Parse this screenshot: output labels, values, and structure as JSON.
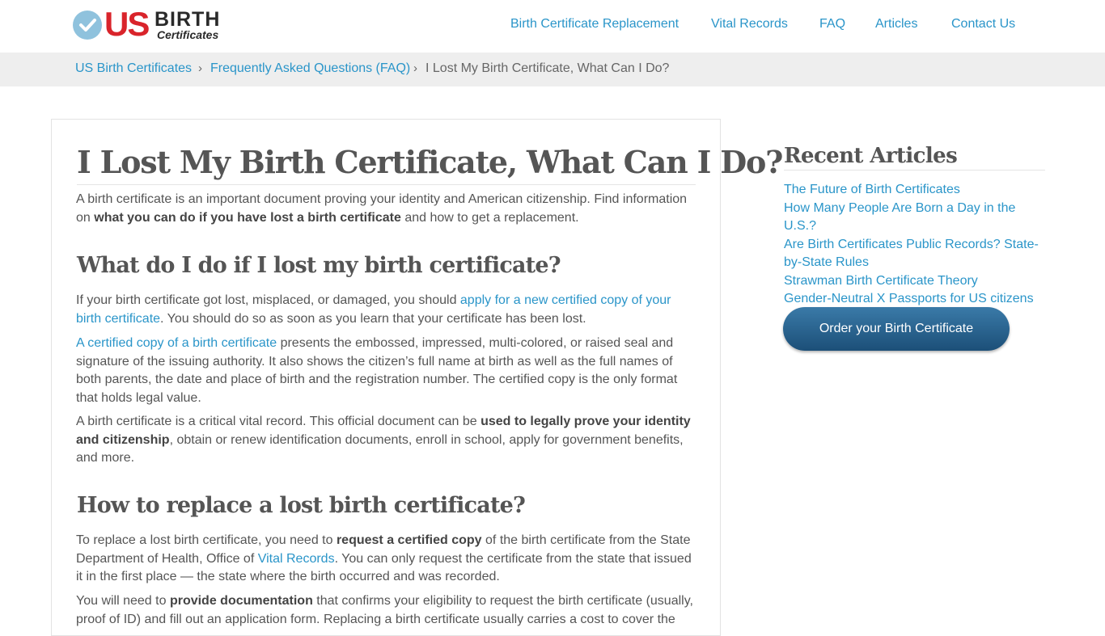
{
  "brand": {
    "logo_us": "US",
    "logo_birth": "BIRTH",
    "logo_certificates": "Certificates"
  },
  "nav": {
    "items": [
      "Birth Certificate Replacement",
      "Vital Records",
      "FAQ",
      "Articles",
      "Contact Us"
    ]
  },
  "breadcrumb": {
    "home": "US Birth Certificates",
    "section": "Frequently Asked Questions (FAQ)",
    "current": "I Lost My Birth Certificate, What Can I Do?",
    "separator": "›"
  },
  "article": {
    "title": "I Lost My Birth Certificate, What Can I Do?",
    "intro": {
      "t1": "A birth certificate is an important document proving your identity and American citizenship. Find information on ",
      "b1": "what you can do if you have lost a birth certificate",
      "t2": " and how to get a replacement."
    },
    "h2_1": "What do I do if I lost my birth certificate?",
    "p1": {
      "t1": "If your birth certificate got lost, misplaced, or damaged, you should ",
      "link": "apply for a new certified copy of your birth certificate",
      "t2": ". You should do so as soon as you learn that your certificate has been lost."
    },
    "p2": {
      "link": "A certified copy of a birth certificate",
      "t1": " presents the embossed, impressed, multi-colored, or raised seal and signature of the issuing authority. It also shows the citizen’s full name at birth as well as the full names of both parents, the date and place of birth and the registration number. The certified copy is the only format that holds legal value."
    },
    "p3": {
      "t1": "A birth certificate is a critical vital record. This official document can be ",
      "b1": "used to legally prove your identity and citizenship",
      "t2": ", obtain or renew identification documents, enroll in school, apply for government benefits, and more."
    },
    "h2_2": "How to replace a lost birth certificate?",
    "p4": {
      "t1": "To replace a lost birth certificate, you need to ",
      "b1": "request a certified copy",
      "t2": " of the birth certificate from the State Department of Health, Office of ",
      "link": "Vital Records",
      "t3": ". You can only request the certificate from the state that issued it in the first place — the state where the birth occurred and was recorded."
    },
    "p5": {
      "t1": "You will need to ",
      "b1": "provide documentation",
      "t2": " that confirms your eligibility to request the birth certificate (usually, proof of ID) and fill out an application form. Replacing a birth certificate usually carries a cost to cover the"
    }
  },
  "sidebar": {
    "title": "Recent Articles",
    "links": [
      "The Future of Birth Certificates",
      "How Many People Are Born a Day in the U.S.?",
      "Are Birth Certificates Public Records? State-by-State Rules",
      "Strawman Birth Certificate Theory",
      "Gender-Neutral X Passports for US citizens"
    ],
    "button": "Order your Birth Certificate"
  },
  "colors": {
    "link": "#2a95c9",
    "brand_red": "#d9242b",
    "button": "#1c4f78"
  }
}
